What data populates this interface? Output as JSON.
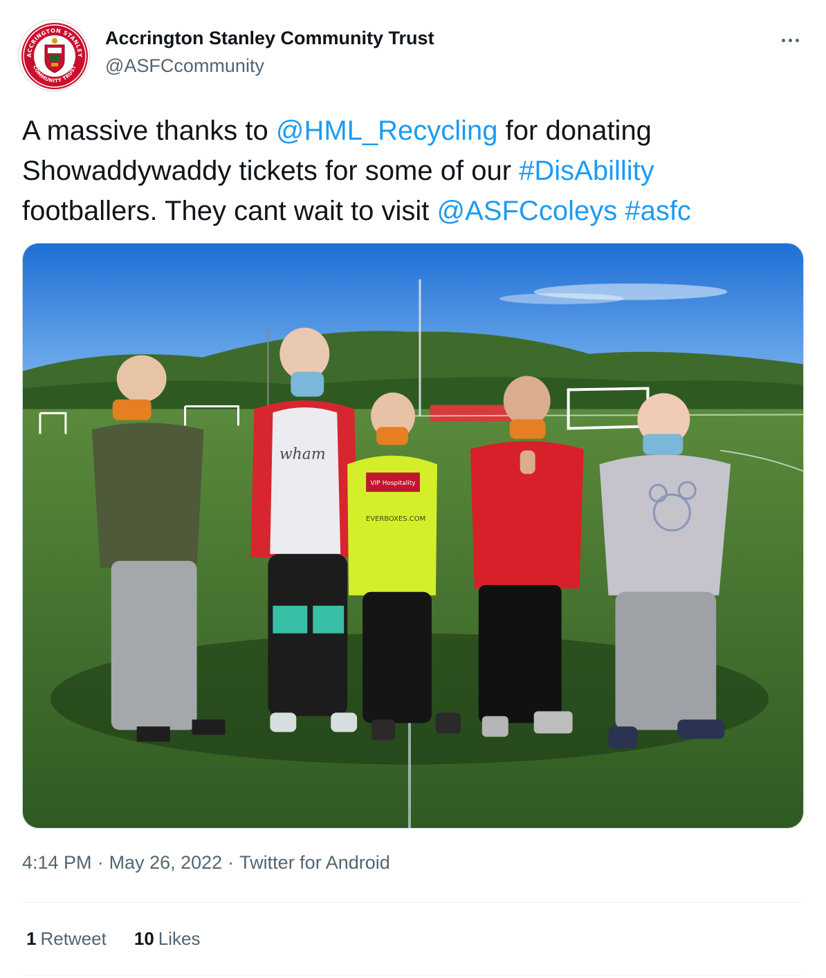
{
  "author": {
    "display_name": "Accrington Stanley Community Trust",
    "handle": "@ASFCcommunity",
    "avatar_icon": "club-crest-icon",
    "crest_text_top": "ACCRINGTON STANLEY",
    "crest_text_bottom": "COMMUNITY TRUST"
  },
  "more_icon": "more-options-icon",
  "tweet": {
    "line1_a": "A massive thanks to ",
    "mention_hml": "@HML_Recycling",
    "line1_b": " for donating",
    "line2_a": "Showaddywaddy tickets for some of our ",
    "hashtag_disability": "#DisAbillity",
    "line3_a": "footballers. They cant wait to visit ",
    "mention_coleys": "@ASFCcoleys",
    "line3_b": " ",
    "hashtag_asfc": "#asfc"
  },
  "photo": {
    "shirt_text": "wham",
    "ticket_text": "VIP Hospitality",
    "sponsor_text": "EVERBOXES.COM"
  },
  "meta": {
    "time": "4:14 PM",
    "separator": "·",
    "date": "May 26, 2022",
    "source": "Twitter for Android"
  },
  "stats": {
    "retweets_count": "1",
    "retweets_label": "Retweet",
    "likes_count": "10",
    "likes_label": "Likes"
  },
  "colors": {
    "link": "#1d9bf0",
    "secondary_text": "#536471",
    "primary_text": "#0f1419"
  }
}
